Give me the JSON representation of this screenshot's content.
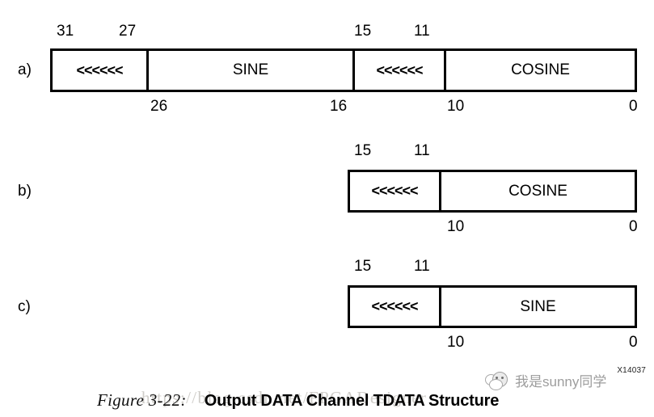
{
  "figure": {
    "id_label": "X14037",
    "caption_number": "Figure 3-22:",
    "caption_title": "Output DATA Channel TDATA Structure"
  },
  "watermarks": {
    "url_text": "https://blog.csdn.net/FPGADesigner",
    "brand_text": "我是sunny同学"
  },
  "rows": [
    {
      "label": "a)",
      "top_labels": [
        "31",
        "27",
        "15",
        "11"
      ],
      "bottom_labels": [
        "26",
        "16",
        "10",
        "0"
      ],
      "cells": [
        {
          "text": "<<<<<<",
          "kind": "padding"
        },
        {
          "text": "SINE",
          "kind": "field"
        },
        {
          "text": "<<<<<<",
          "kind": "padding"
        },
        {
          "text": "COSINE",
          "kind": "field"
        }
      ]
    },
    {
      "label": "b)",
      "top_labels": [
        "15",
        "11"
      ],
      "bottom_labels": [
        "10",
        "0"
      ],
      "cells": [
        {
          "text": "<<<<<<",
          "kind": "padding"
        },
        {
          "text": "COSINE",
          "kind": "field"
        }
      ]
    },
    {
      "label": "c)",
      "top_labels": [
        "15",
        "11"
      ],
      "bottom_labels": [
        "10",
        "0"
      ],
      "cells": [
        {
          "text": "<<<<<<",
          "kind": "padding"
        },
        {
          "text": "SINE",
          "kind": "field"
        }
      ]
    }
  ]
}
